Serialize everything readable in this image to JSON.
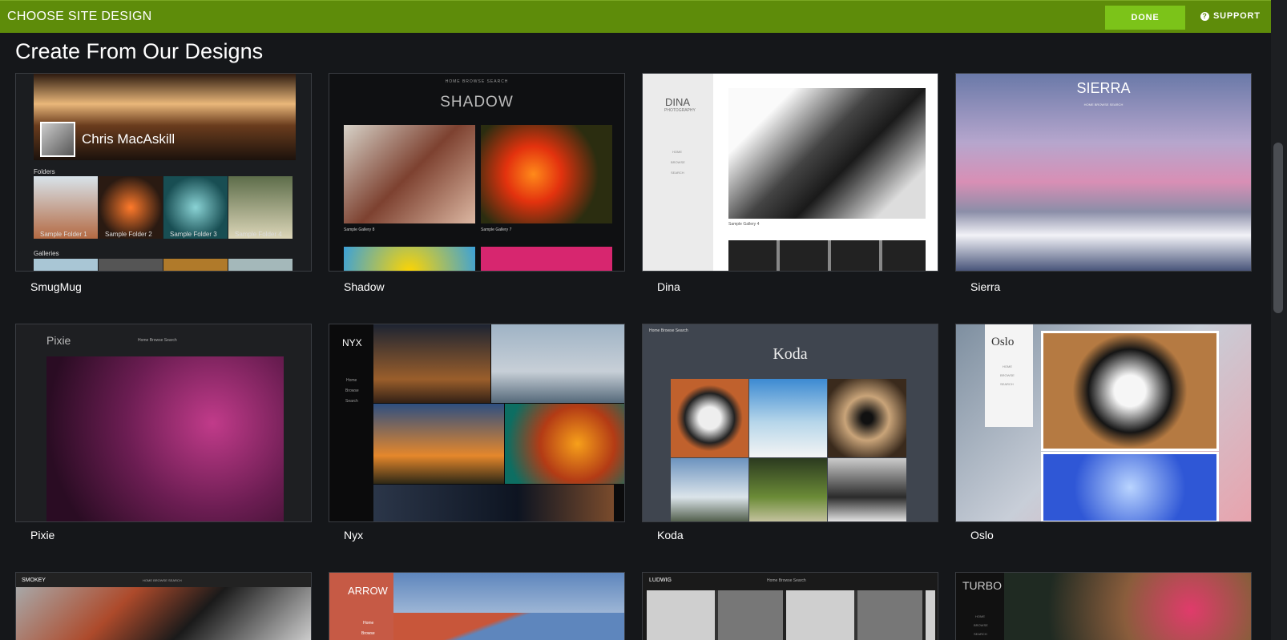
{
  "header": {
    "title": "CHOOSE SITE DESIGN",
    "done_label": "DONE",
    "support_label": "SUPPORT"
  },
  "section": {
    "heading": "Create From Our Designs"
  },
  "designs": [
    {
      "name": "SmugMug",
      "thumb": {
        "title": "Chris MacAskill",
        "folders": "Folders",
        "galleries": "Galleries",
        "captions": [
          "Sample Folder 1",
          "Sample Folder 2",
          "Sample Folder 3",
          "Sample Folder 4"
        ]
      }
    },
    {
      "name": "Shadow",
      "thumb": {
        "title": "SHADOW",
        "nav": "HOME  BROWSE  SEARCH",
        "captions": [
          "Sample Gallery 8",
          "Sample Gallery 7"
        ]
      }
    },
    {
      "name": "Dina",
      "thumb": {
        "title": "DINA",
        "subtitle": "PHOTOGRAPHY",
        "nav": [
          "HOME",
          "BROWSE",
          "SEARCH"
        ],
        "caption": "Sample Gallery 4"
      }
    },
    {
      "name": "Sierra",
      "thumb": {
        "title": "SIERRA",
        "nav": "HOME  BROWSE  SEARCH"
      }
    },
    {
      "name": "Pixie",
      "thumb": {
        "title": "Pixie",
        "nav": "Home  Browse  Search"
      }
    },
    {
      "name": "Nyx",
      "thumb": {
        "title": "NYX",
        "nav": [
          "Home",
          "Browse",
          "Search"
        ]
      }
    },
    {
      "name": "Koda",
      "thumb": {
        "title": "Koda",
        "nav": "Home  Browse  Search"
      }
    },
    {
      "name": "Oslo",
      "thumb": {
        "title": "Oslo",
        "nav": [
          "HOME",
          "BROWSE",
          "SEARCH"
        ]
      }
    },
    {
      "name": "Smokey",
      "thumb": {
        "title": "SMOKEY",
        "nav": "HOME  BROWSE  SEARCH"
      }
    },
    {
      "name": "Arrow",
      "thumb": {
        "title": "ARROW",
        "nav": [
          "Home",
          "Browse"
        ]
      }
    },
    {
      "name": "Ludwig",
      "thumb": {
        "title": "LUDWIG",
        "nav": "Home  Browse  Search"
      }
    },
    {
      "name": "Turbo",
      "thumb": {
        "title": "TURBO",
        "nav": [
          "HOME",
          "BROWSE",
          "SEARCH"
        ]
      }
    }
  ],
  "colors": {
    "header_bg": "#5e8c0a",
    "done_bg": "#7cc319",
    "page_bg": "#15171a"
  }
}
